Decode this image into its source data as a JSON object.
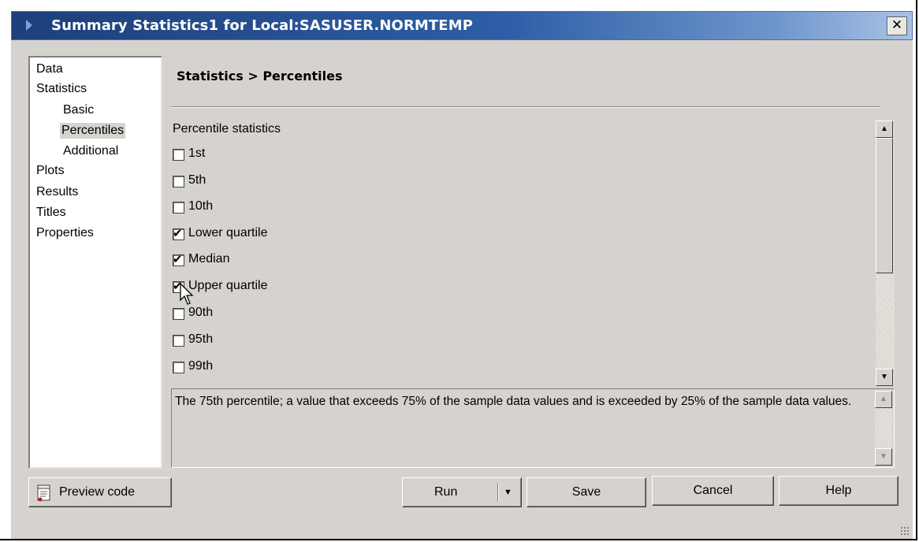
{
  "window": {
    "title": "Summary Statistics1 for Local:SASUSER.NORMTEMP",
    "close_glyph": "✕"
  },
  "nav": {
    "items": [
      {
        "label": "Data",
        "indent": 0,
        "selected": false
      },
      {
        "label": "Statistics",
        "indent": 0,
        "selected": false
      },
      {
        "label": "Basic",
        "indent": 1,
        "selected": false
      },
      {
        "label": "Percentiles",
        "indent": 1,
        "selected": true
      },
      {
        "label": "Additional",
        "indent": 1,
        "selected": false
      },
      {
        "label": "Plots",
        "indent": 0,
        "selected": false
      },
      {
        "label": "Results",
        "indent": 0,
        "selected": false
      },
      {
        "label": "Titles",
        "indent": 0,
        "selected": false
      },
      {
        "label": "Properties",
        "indent": 0,
        "selected": false
      }
    ]
  },
  "main": {
    "section_title": "Statistics > Percentiles",
    "group_label": "Percentile statistics",
    "checkboxes": [
      {
        "label": "1st",
        "checked": false
      },
      {
        "label": "5th",
        "checked": false
      },
      {
        "label": "10th",
        "checked": false
      },
      {
        "label": "Lower quartile",
        "checked": true
      },
      {
        "label": "Median",
        "checked": true
      },
      {
        "label": "Upper quartile",
        "checked": true
      },
      {
        "label": "90th",
        "checked": false
      },
      {
        "label": "95th",
        "checked": false
      },
      {
        "label": "99th",
        "checked": false
      }
    ],
    "description": "The 75th percentile; a value that exceeds 75% of the sample data values and is exceeded by 25% of the sample data values."
  },
  "buttons": {
    "preview_code": "Preview code",
    "run": "Run",
    "save": "Save",
    "cancel": "Cancel",
    "help": "Help"
  },
  "glyphs": {
    "check": "✔",
    "scroll_up": "▲",
    "scroll_down": "▼",
    "dropdown": "▼"
  },
  "colors": {
    "title_bar_start": "#1e3f7a",
    "title_bar_end": "#a9c3e6",
    "dialog_face": "#d6d3ce",
    "nav_selected": "#d6d3ce"
  }
}
